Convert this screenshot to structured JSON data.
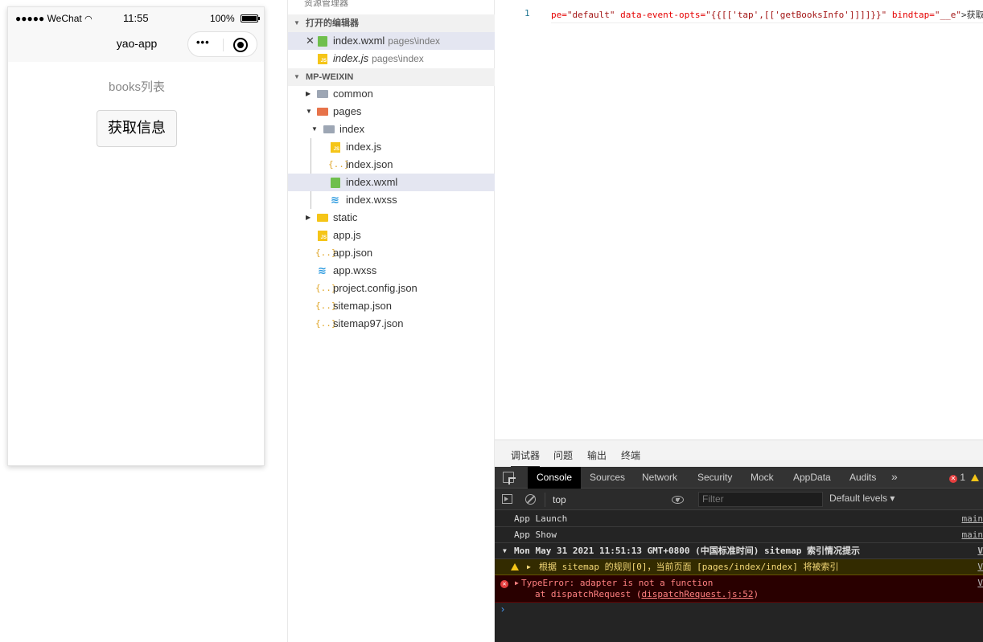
{
  "simulator": {
    "statusbar": {
      "signal": "●●●●● WeChat",
      "wifi_icon": "wifi-icon",
      "time": "11:55",
      "battery_percent": "100%",
      "battery_level": 1.0
    },
    "navbar": {
      "title": "yao-app",
      "menu_dots": "•••"
    },
    "page": {
      "title": "books列表",
      "get_info_button": "获取信息"
    }
  },
  "explorer": {
    "top_cut_label": "资源管理器",
    "open_editors_label": "打开的编辑器",
    "open_editors": [
      {
        "name": "index.wxml",
        "path": "pages\\index",
        "icon": "wxml-file-icon"
      },
      {
        "name": "index.js",
        "path": "pages\\index",
        "icon": "js-file-icon"
      }
    ],
    "project_label": "MP-WEIXIN",
    "tree": [
      {
        "name": "common",
        "icon": "folder-icon"
      },
      {
        "name": "pages",
        "icon": "folder-icon"
      },
      {
        "name": "index",
        "icon": "folder-open-icon"
      },
      {
        "name": "index.js",
        "icon": "js-file-icon"
      },
      {
        "name": "index.json",
        "icon": "json-file-icon"
      },
      {
        "name": "index.wxml",
        "icon": "wxml-file-icon"
      },
      {
        "name": "index.wxss",
        "icon": "wxss-file-icon"
      },
      {
        "name": "static",
        "icon": "folder-icon"
      },
      {
        "name": "app.js",
        "icon": "js-file-icon"
      },
      {
        "name": "app.json",
        "icon": "json-file-icon"
      },
      {
        "name": "app.wxss",
        "icon": "wxss-file-icon"
      },
      {
        "name": "project.config.json",
        "icon": "json-file-icon"
      },
      {
        "name": "sitemap.json",
        "icon": "json-file-icon"
      },
      {
        "name": "sitemap97.json",
        "icon": "json-file-icon"
      }
    ]
  },
  "editor": {
    "line_number": "1",
    "code_parts": [
      "pe=",
      "\"default\"",
      " data-event-opts=",
      "\"{{[['tap',[['getBooksInfo']]]]}}\"",
      " bindtap=",
      "\"__e\"",
      ">获取"
    ]
  },
  "debugger": {
    "tabs": [
      "调试器",
      "问题",
      "输出",
      "终端"
    ],
    "devtools_tabs": [
      "Console",
      "Sources",
      "Network",
      "Security",
      "Mock",
      "AppData",
      "Audits"
    ],
    "more_tabs": "»",
    "error_count": "1",
    "context": "top",
    "filter_placeholder": "Filter",
    "levels": "Default levels ▾",
    "logs": [
      {
        "text": "App Launch",
        "source": "main"
      },
      {
        "text": "App Show",
        "source": "main"
      },
      {
        "text": "Mon May 31 2021 11:51:13 GMT+0800 (中国标准时间) sitemap 索引情况提示",
        "source": "V"
      },
      {
        "text": "根据 sitemap 的规则[0]，当前页面 [pages/index/index] 将被索引",
        "source": "V"
      },
      {
        "text": "TypeError: adapter is not a function",
        "source": "V"
      },
      {
        "text": "at dispatchRequest (",
        "link": "dispatchRequest.js:52",
        "after": ")"
      }
    ],
    "prompt": "›"
  }
}
